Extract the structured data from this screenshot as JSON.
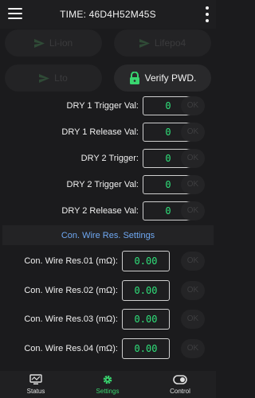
{
  "header": {
    "title": "TIME: 46D4H52M45S"
  },
  "chemistry": [
    {
      "label": "Li-ion"
    },
    {
      "label": "Lifepo4"
    },
    {
      "label": "Lto"
    }
  ],
  "verify": {
    "label": "Verify PWD."
  },
  "dry_rows": [
    {
      "label": "DRY 1 Trigger Val:",
      "value": "0",
      "ok": "OK"
    },
    {
      "label": "DRY 1 Release Val:",
      "value": "0",
      "ok": "OK"
    },
    {
      "label": "DRY 2 Trigger:",
      "value": "0",
      "ok": "OK"
    },
    {
      "label": "DRY 2 Trigger Val:",
      "value": "0",
      "ok": "OK"
    },
    {
      "label": "DRY 2 Release Val:",
      "value": "0",
      "ok": "OK"
    }
  ],
  "section": {
    "title": "Con. Wire Res. Settings"
  },
  "wire_rows": [
    {
      "label": "Con. Wire Res.01 (mΩ):",
      "value": "0.00",
      "ok": "OK"
    },
    {
      "label": "Con. Wire Res.02 (mΩ):",
      "value": "0.00",
      "ok": "OK"
    },
    {
      "label": "Con. Wire Res.03 (mΩ):",
      "value": "0.00",
      "ok": "OK"
    },
    {
      "label": "Con. Wire Res.04 (mΩ):",
      "value": "0.00",
      "ok": "OK"
    }
  ],
  "nav": [
    {
      "label": "Status",
      "icon": "monitor-icon"
    },
    {
      "label": "Settings",
      "icon": "gear-icon"
    },
    {
      "label": "Control",
      "icon": "toggle-icon"
    }
  ],
  "colors": {
    "accent_green": "#39d66f",
    "section_blue": "#6fa8f2",
    "value_green": "#2fe07a"
  }
}
